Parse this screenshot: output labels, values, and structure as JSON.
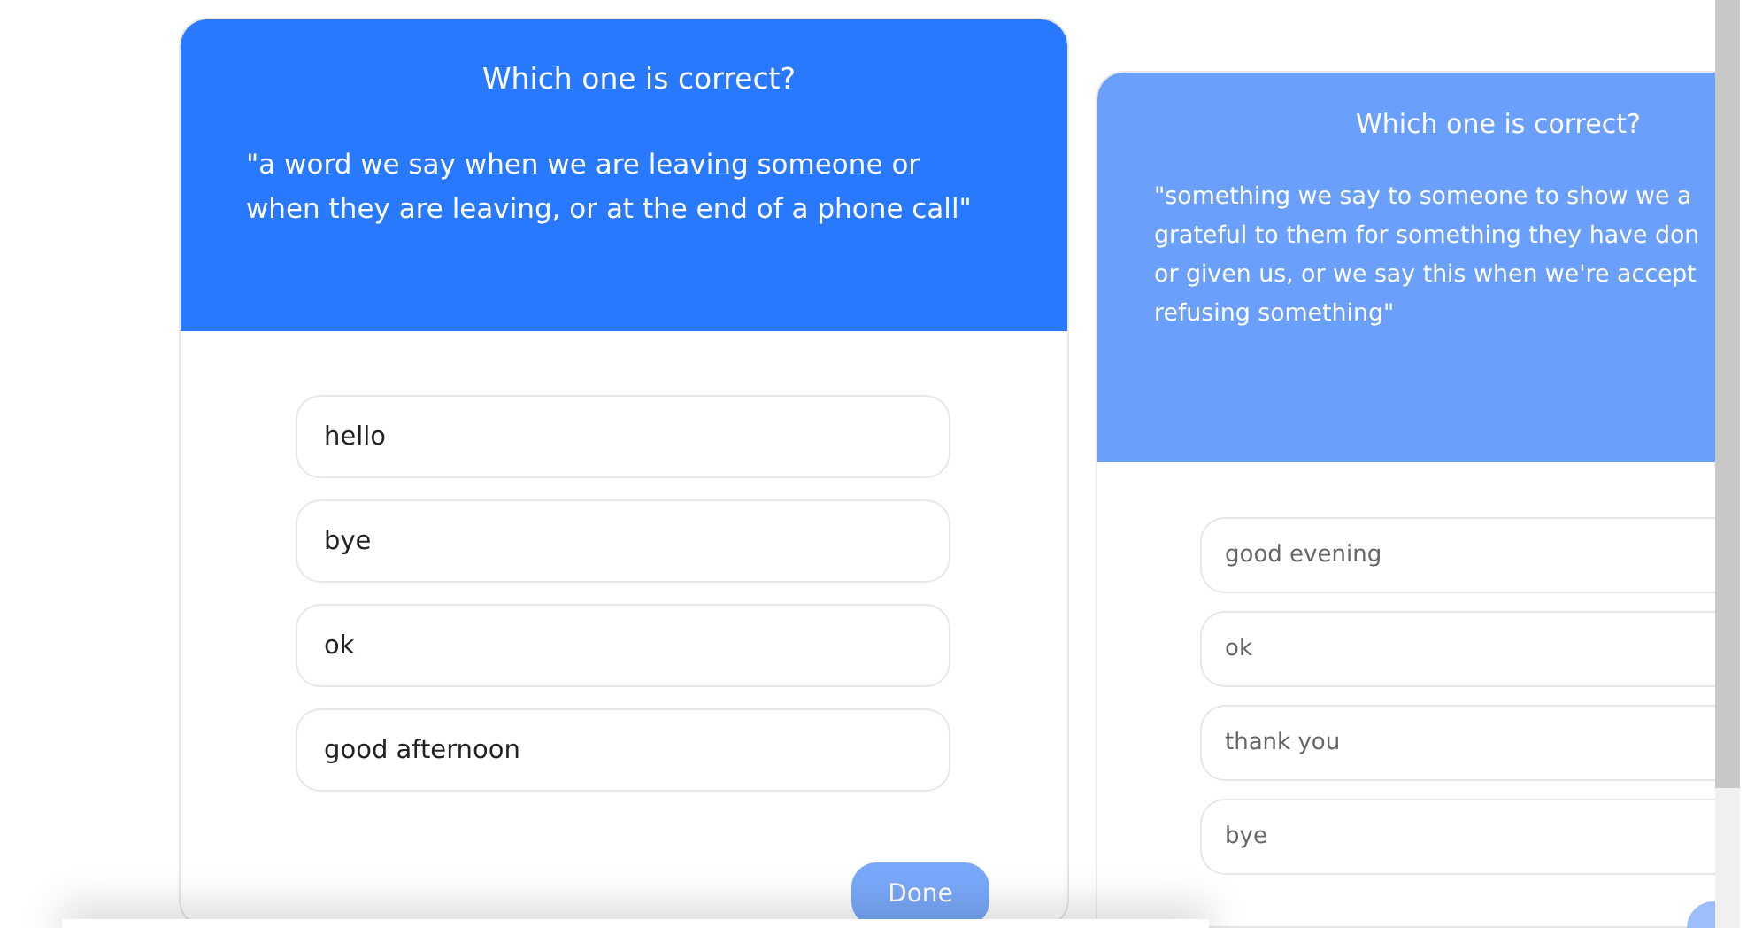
{
  "cards": [
    {
      "active": true,
      "title": "Which one is correct?",
      "quote": "\"a word we say when we are leaving someone or\nwhen they are leaving, or at the end of a phone call\"",
      "options": [
        "hello",
        "bye",
        "ok",
        "good afternoon"
      ],
      "button": "Done"
    },
    {
      "active": false,
      "title": "Which one is correct?",
      "quote": "\"something we say to someone to show we a\ngrateful to them for something they have don\nor given us, or we say this when we're accept\nrefusing something\"",
      "options": [
        "good evening",
        "ok",
        "thank you",
        "bye"
      ]
    }
  ]
}
